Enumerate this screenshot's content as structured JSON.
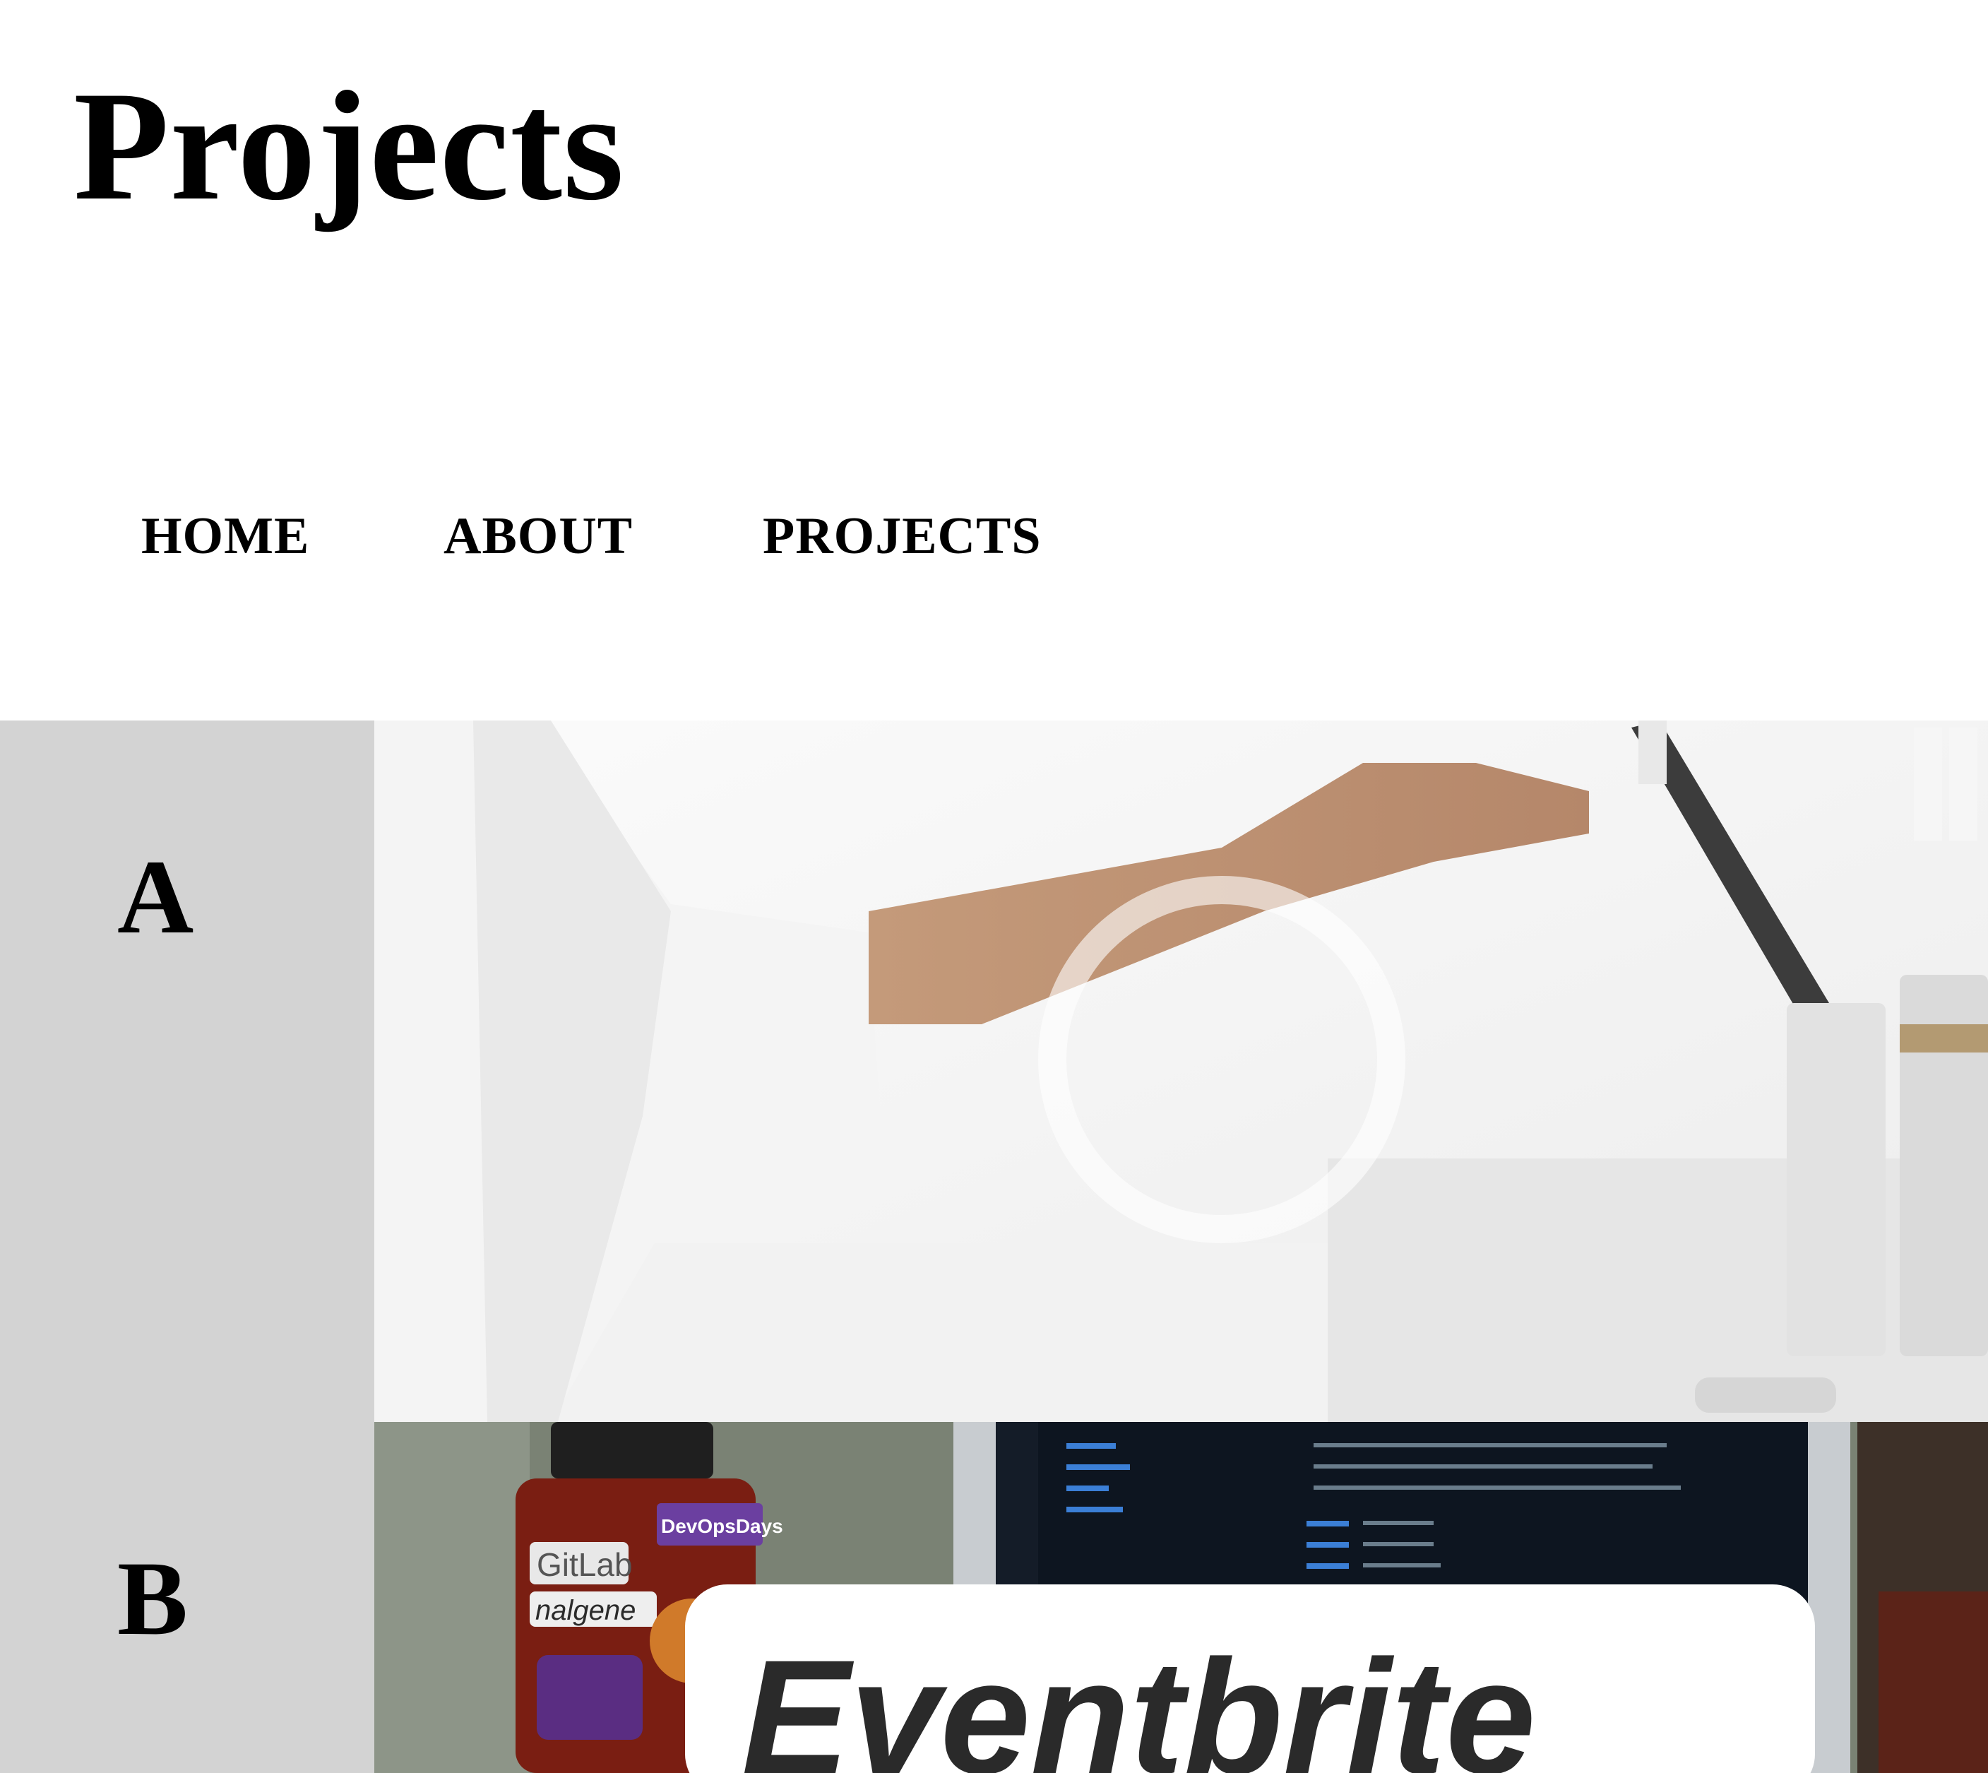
{
  "page": {
    "title": "Projects"
  },
  "nav": {
    "items": [
      {
        "label": "HOME"
      },
      {
        "label": "ABOUT"
      },
      {
        "label": "PROJECTS"
      }
    ]
  },
  "projects": [
    {
      "label": "A",
      "image": "bathroom-toothbrush-photo"
    },
    {
      "label": "B",
      "image": "developer-desk-eventbrite-photo"
    }
  ],
  "photo_text": {
    "sticker_gitlab": "GitLab",
    "sticker_nalgene": "nalgene",
    "sticker_devopsdays": "DevOpsDays",
    "sign_eventbrite": "Eventbrite"
  },
  "colors": {
    "label_bg": "#d3d3d3",
    "text": "#000000",
    "background": "#ffffff"
  }
}
